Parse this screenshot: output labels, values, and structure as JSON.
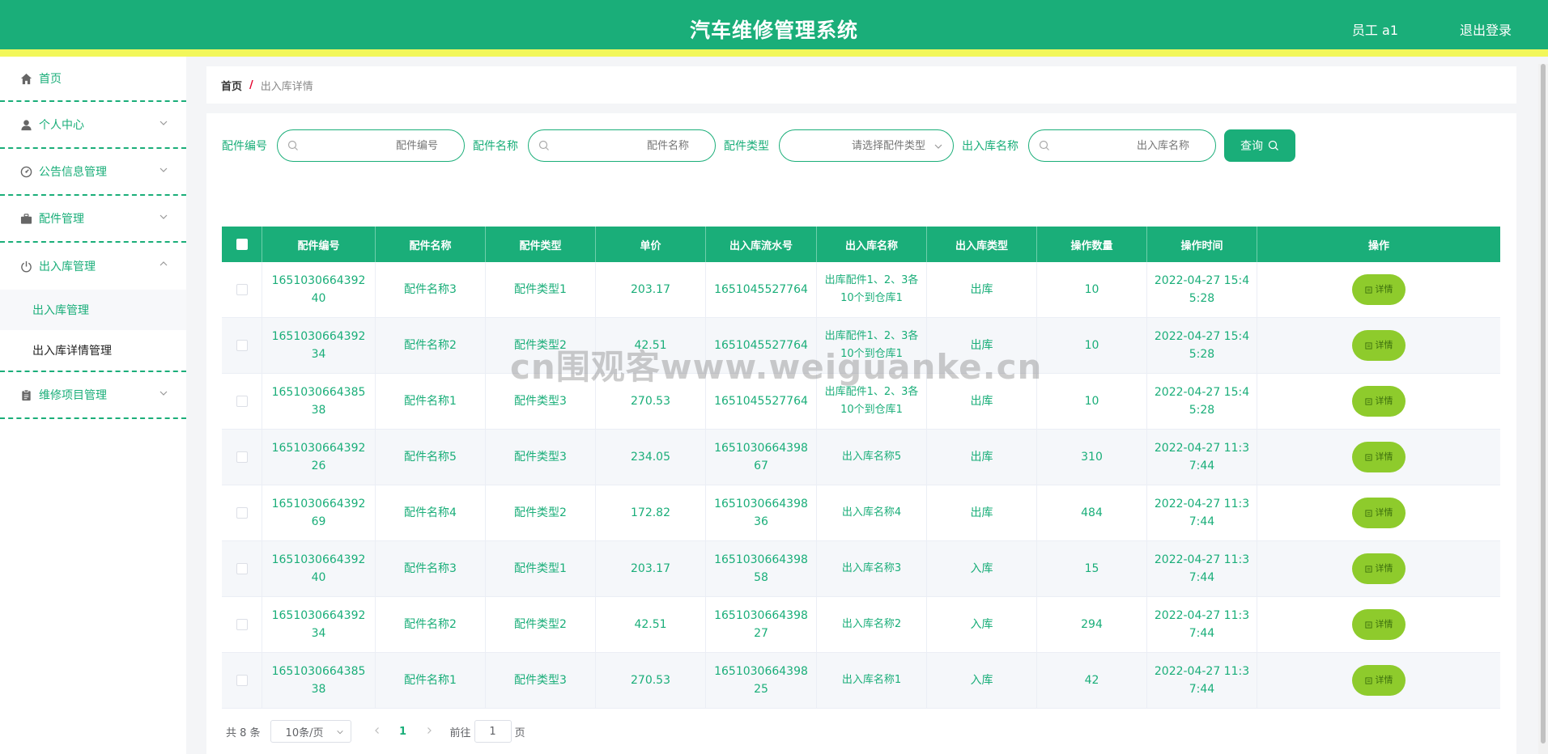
{
  "header": {
    "title": "汽车维修管理系统",
    "user": "员工 a1",
    "logout": "退出登录"
  },
  "sidebar": {
    "items": [
      {
        "label": "首页",
        "icon": "home-icon"
      },
      {
        "label": "个人中心",
        "icon": "user-icon"
      },
      {
        "label": "公告信息管理",
        "icon": "dashboard-icon"
      },
      {
        "label": "配件管理",
        "icon": "briefcase-icon"
      },
      {
        "label": "出入库管理",
        "icon": "power-icon"
      },
      {
        "label": "维修项目管理",
        "icon": "clipboard-icon"
      }
    ],
    "submenu": [
      "出入库管理",
      "出入库详情管理"
    ]
  },
  "breadcrumb": {
    "home": "首页",
    "sep": "/",
    "current": "出入库详情"
  },
  "search": {
    "part_code_label": "配件编号",
    "part_code_placeholder": "配件编号",
    "part_name_label": "配件名称",
    "part_name_placeholder": "配件名称",
    "part_type_label": "配件类型",
    "part_type_placeholder": "请选择配件类型",
    "io_name_label": "出入库名称",
    "io_name_placeholder": "出入库名称",
    "query_label": "查询"
  },
  "table": {
    "columns": [
      "配件编号",
      "配件名称",
      "配件类型",
      "单价",
      "出入库流水号",
      "出入库名称",
      "出入库类型",
      "操作数量",
      "操作时间",
      "操作"
    ],
    "detail_label": "详情",
    "rows": [
      [
        "165103066439240",
        "配件名称3",
        "配件类型1",
        "203.17",
        "1651045527764",
        "出库配件1、2、3各10个到仓库1",
        "出库",
        "10",
        "2022-04-27 15:45:28"
      ],
      [
        "165103066439234",
        "配件名称2",
        "配件类型2",
        "42.51",
        "1651045527764",
        "出库配件1、2、3各10个到仓库1",
        "出库",
        "10",
        "2022-04-27 15:45:28"
      ],
      [
        "165103066438538",
        "配件名称1",
        "配件类型3",
        "270.53",
        "1651045527764",
        "出库配件1、2、3各10个到仓库1",
        "出库",
        "10",
        "2022-04-27 15:45:28"
      ],
      [
        "165103066439226",
        "配件名称5",
        "配件类型3",
        "234.05",
        "165103066439867",
        "出入库名称5",
        "出库",
        "310",
        "2022-04-27 11:37:44"
      ],
      [
        "165103066439269",
        "配件名称4",
        "配件类型2",
        "172.82",
        "165103066439836",
        "出入库名称4",
        "出库",
        "484",
        "2022-04-27 11:37:44"
      ],
      [
        "165103066439240",
        "配件名称3",
        "配件类型1",
        "203.17",
        "165103066439858",
        "出入库名称3",
        "入库",
        "15",
        "2022-04-27 11:37:44"
      ],
      [
        "165103066439234",
        "配件名称2",
        "配件类型2",
        "42.51",
        "165103066439827",
        "出入库名称2",
        "入库",
        "294",
        "2022-04-27 11:37:44"
      ],
      [
        "165103066438538",
        "配件名称1",
        "配件类型3",
        "270.53",
        "165103066439825",
        "出入库名称1",
        "入库",
        "42",
        "2022-04-27 11:37:44"
      ]
    ]
  },
  "pager": {
    "total": "共 8 条",
    "page_size": "10条/页",
    "current_page": "1",
    "goto_prefix": "前往",
    "goto_value": "1",
    "goto_suffix": "页"
  },
  "watermark": "cn围观客www.weiguanke.cn",
  "colors": {
    "primary": "#1aae79",
    "accent_bar": "#f2f75a",
    "detail_button": "#8ecb2c"
  }
}
